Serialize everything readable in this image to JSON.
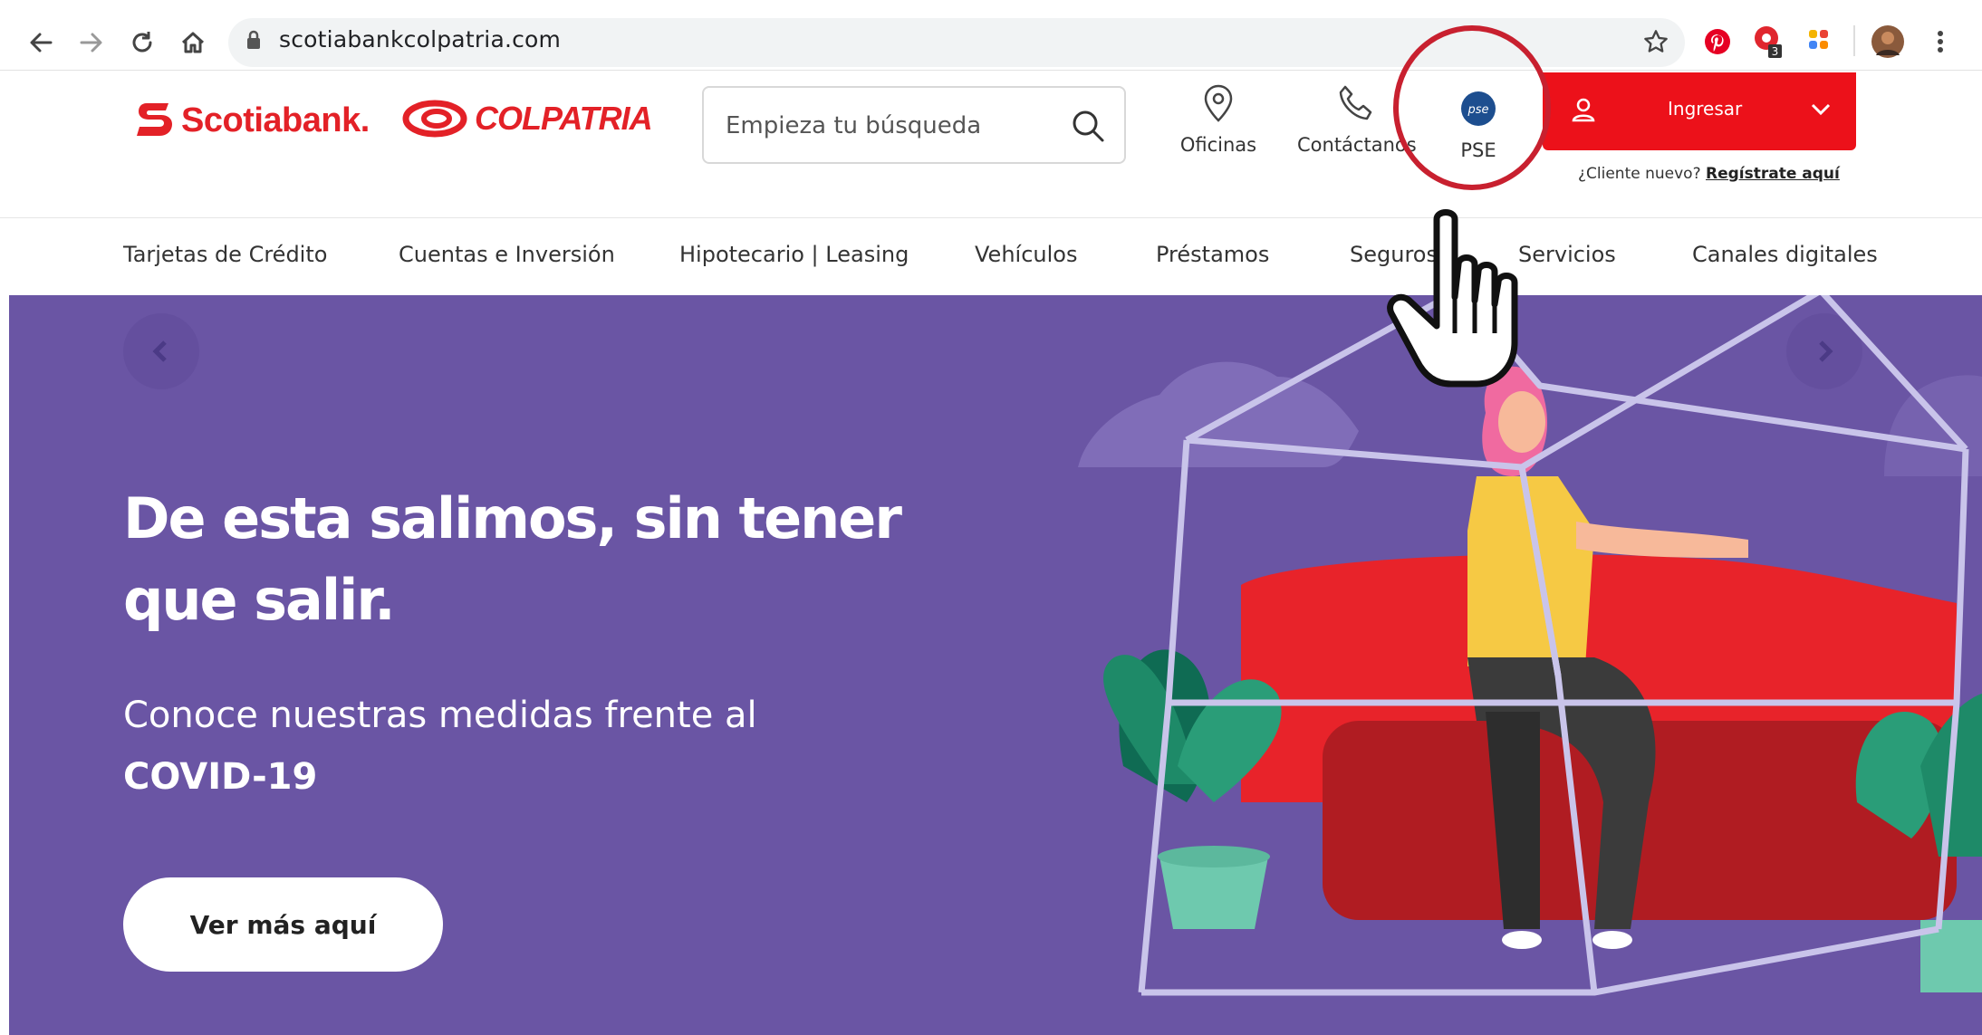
{
  "browser": {
    "url": "scotiabankcolpatria.com",
    "extension_badge": "3",
    "icons": [
      "back-arrow-icon",
      "forward-arrow-icon",
      "reload-icon",
      "home-icon",
      "lock-icon",
      "star-icon",
      "pinterest-icon",
      "extension-icon",
      "grid-extension-icon",
      "profile-avatar",
      "more-vert-icon"
    ]
  },
  "header": {
    "logo_scotia": "Scotiabank.",
    "logo_colpatria": "COLPATRIA",
    "search": {
      "placeholder": "Empieza tu búsqueda",
      "value": ""
    },
    "utilities": [
      {
        "label": "Oficinas",
        "icon": "location-pin-icon"
      },
      {
        "label": "Contáctanos",
        "icon": "phone-icon"
      },
      {
        "label": "PSE",
        "icon": "pse-logo-icon"
      }
    ],
    "login": {
      "label": "Ingresar"
    },
    "new_client": {
      "prefix": "¿Cliente nuevo?",
      "link": "Regístrate aquí"
    }
  },
  "menu": {
    "items": [
      "Tarjetas de Crédito",
      "Cuentas e Inversión",
      "Hipotecario | Leasing",
      "Vehículos",
      "Préstamos",
      "Seguros",
      "Servicios",
      "Canales digitales"
    ]
  },
  "hero": {
    "title": "De esta salimos, sin tener que salir.",
    "subtitle_line": "Conoce nuestras medidas frente al",
    "subtitle_bold": "COVID-19",
    "cta": "Ver más aquí",
    "background_color": "#6a55a4"
  },
  "colors": {
    "brand_red": "#ec111a",
    "annotation_red": "#c8202f"
  }
}
